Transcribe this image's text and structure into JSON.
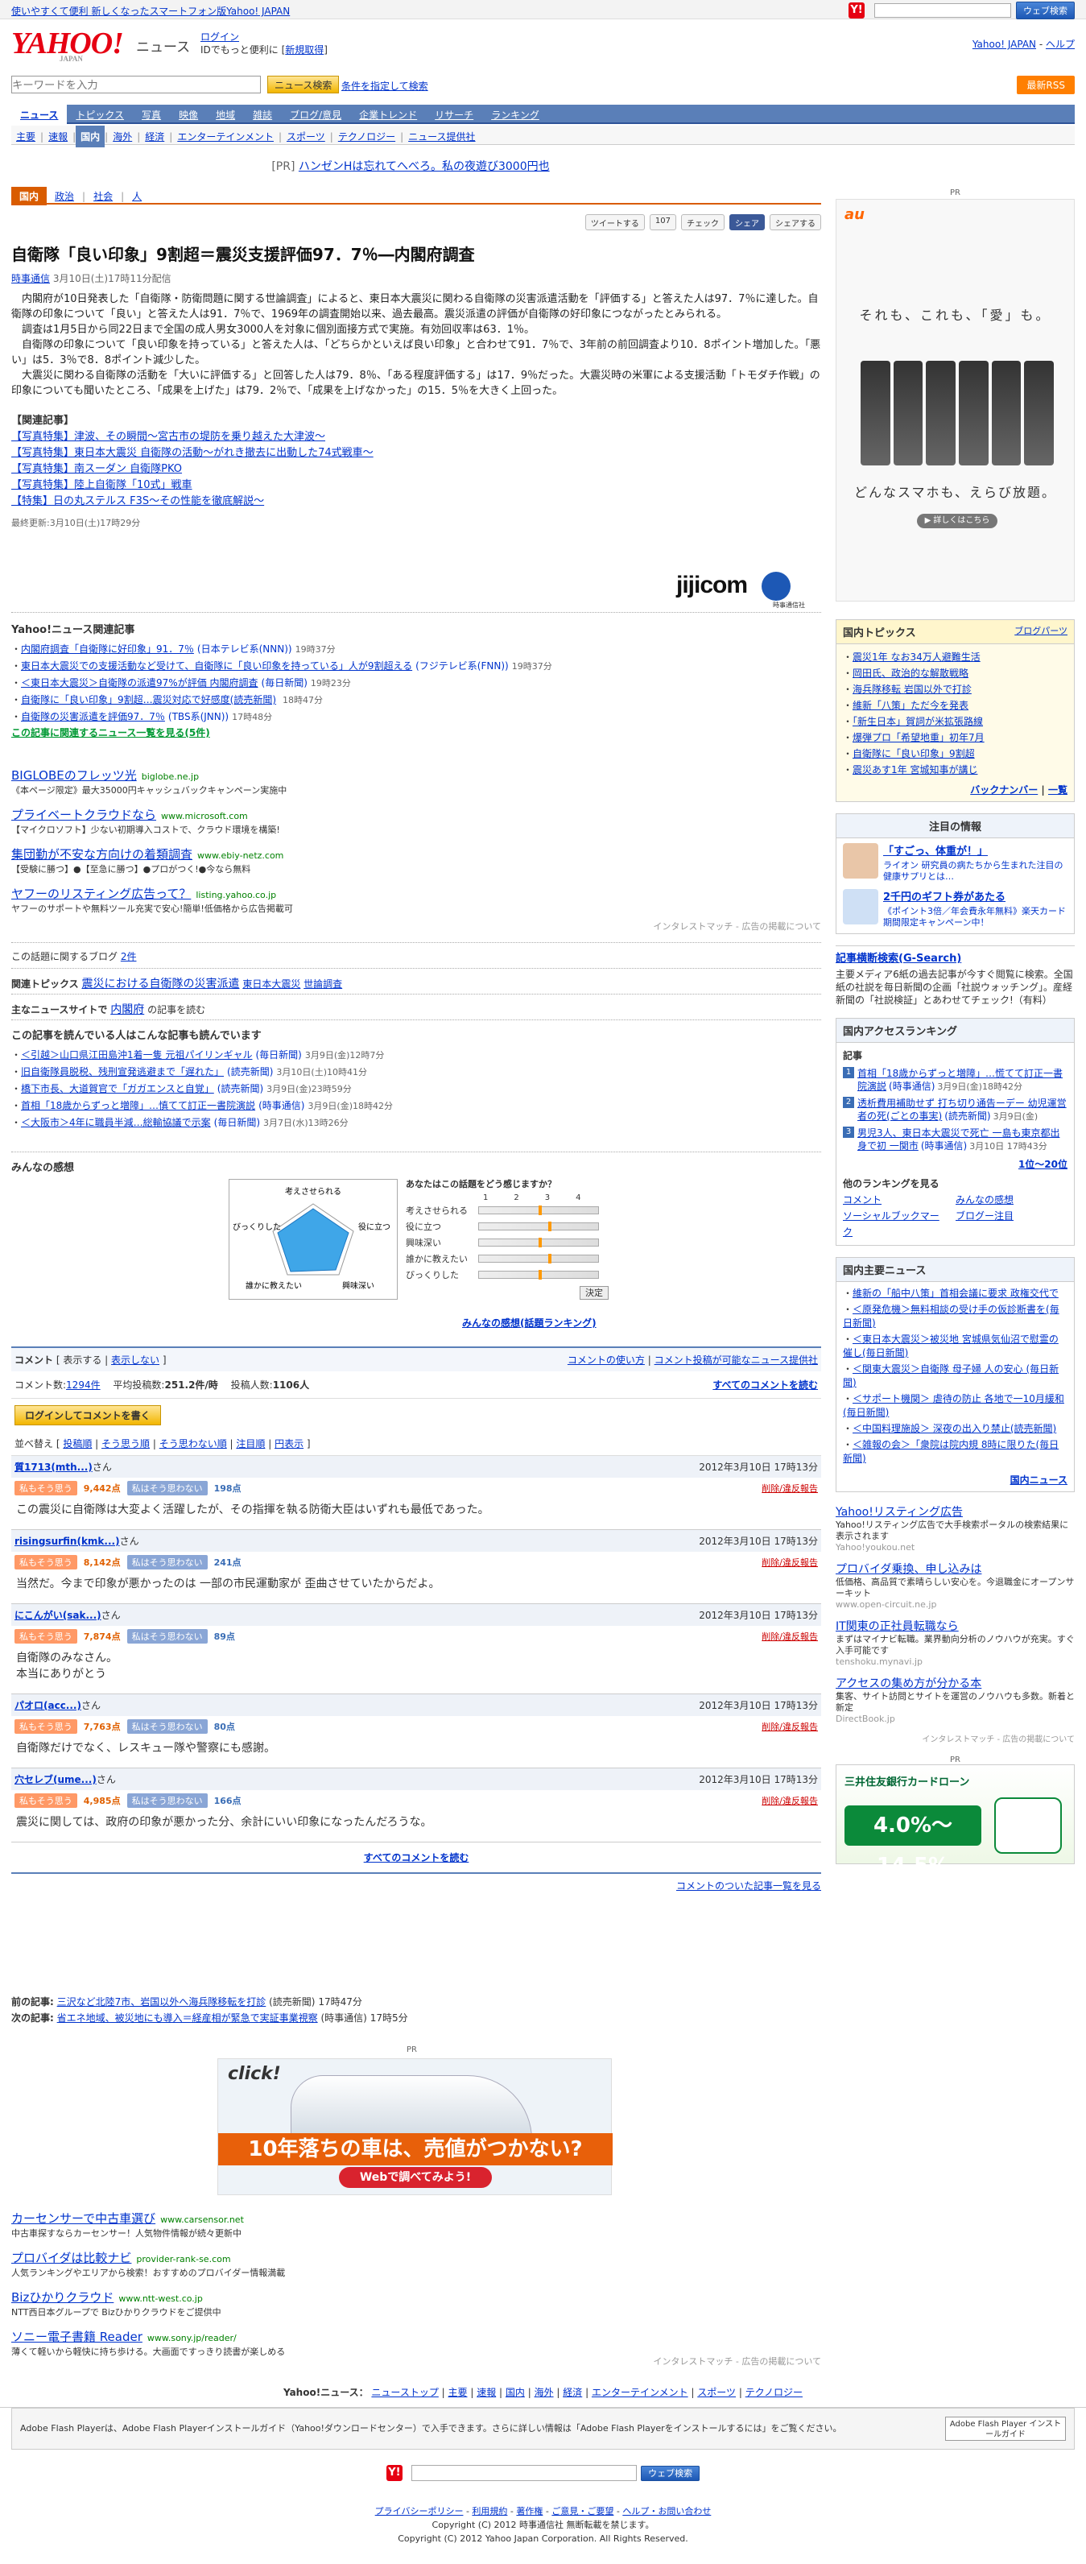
{
  "topbar": {
    "promo": "使いやすくて便利 新しくなったスマートフォン版Yahoo! JAPAN",
    "search_button": "ウェブ検索",
    "y_icon": "Y!"
  },
  "header": {
    "logo": "YAHOO!",
    "logo_sub": "JAPAN",
    "section": "ニュース",
    "login": "ログイン",
    "login_note": "IDでもっと便利に",
    "register": "新規取得",
    "right_link": "Yahoo! JAPAN",
    "help": "ヘルプ"
  },
  "search": {
    "placeholder": "キーワードを入力",
    "button": "ニュース検索",
    "advanced": "条件を指定して検索",
    "rss": "最新RSS"
  },
  "nav": [
    "ニュース",
    "トピックス",
    "写真",
    "映像",
    "地域",
    "雑誌",
    "ブログ/意見",
    "企業トレンド",
    "リサーチ",
    "ランキング"
  ],
  "subnav": [
    "主要",
    "速報",
    "国内",
    "海外",
    "経済",
    "エンターテインメント",
    "スポーツ",
    "テクノロジー",
    "ニュース提供社"
  ],
  "pr_line": {
    "label": "[PR]",
    "text": "ハンゼンHは忘れてへべろ。私の夜遊び3000円也"
  },
  "cattabs": [
    "国内",
    "政治",
    "社会",
    "人"
  ],
  "social": {
    "tweet": "ツイートする",
    "tweet_count": "107",
    "check": "チェック",
    "fb": "シェア",
    "share": "シェアする"
  },
  "article": {
    "title": "自衛隊「良い印象」9割超＝震災支援評価97．7％―内閣府調査",
    "source": "時事通信",
    "date": "3月10日(土)17時11分配信",
    "paragraphs": [
      "　内閣府が10日発表した「自衛隊・防衛問題に関する世論調査」によると、東日本大震災に関わる自衛隊の災害派遣活動を「評価する」と答えた人は97．7％に達した。自衛隊の印象について「良い」と答えた人は91．7％で、1969年の調査開始以来、過去最高。震災派遣の評価が自衛隊の好印象につながったとみられる。",
      "　調査は1月5日から同22日まで全国の成人男女3000人を対象に個別面接方式で実施。有効回収率は63．1％。",
      "　自衛隊の印象について「良い印象を持っている」と答えた人は、「どちらかといえば良い印象」と合わせて91．7％で、3年前の前回調査より10．8ポイント増加した。「悪い」は5．3％で8．8ポイント減少した。",
      "　大震災に関わる自衛隊の活動を「大いに評価する」と回答した人は79．8％、「ある程度評価する」は17．9％だった。大震災時の米軍による支援活動「トモダチ作戦」の印象についても聞いたところ、「成果を上げた」は79．2％で、「成果を上げなかった」の15．5％を大きく上回った。"
    ],
    "related_heading": "【関連記事】",
    "related": [
      "【写真特集】津波、その瞬間～宮古市の堤防を乗り越えた大津波～",
      "【写真特集】東日本大震災 自衛隊の活動～がれき撤去に出動した74式戦車～",
      "【写真特集】南スーダン 自衛隊PKO",
      "【写真特集】陸上自衛隊「10式」戦車",
      "【特集】日の丸ステルス F3S～その性能を徹底解説～"
    ],
    "final": "最終更新:3月10日(土)17時29分",
    "jiji_logo": "jijicom",
    "jiji_label": "時事通信社"
  },
  "related_news": {
    "heading": "Yahoo!ニュース関連記事",
    "items": [
      {
        "t": "内閣府調査「自衛隊に好印象」91．7％",
        "s": "(日本テレビ系(NNN))",
        "d": "19時37分"
      },
      {
        "t": "東日本大震災での支援活動など受けて、自衛隊に「良い印象を持っている」人が9割超える",
        "s": "(フジテレビ系(FNN))",
        "d": "19時37分"
      },
      {
        "t": "＜東日本大震災＞自衛隊の派遣97%が評価 内閣府調査",
        "s": "(毎日新聞)",
        "d": "19時23分"
      },
      {
        "t": "自衛隊に「良い印象」9割超…震災対応で好感度(読売新聞)",
        "s": "",
        "d": "18時47分"
      },
      {
        "t": "自衛隊の災害派遣を評価97．7％",
        "s": "(TBS系(JNN))",
        "d": "17時48分"
      }
    ],
    "more": "この記事に関連するニュース一覧を見る(5件)"
  },
  "ads1": [
    {
      "t": "BIGLOBEのフレッツ光",
      "u": "biglobe.ne.jp",
      "d": "《本ページ限定》最大35000円キャッシュバックキャンペーン実施中"
    },
    {
      "t": "プライベートクラウドなら",
      "u": "www.microsoft.com",
      "d": "【マイクロソフト】少ない初期導入コストで、クラウド環境を構築!"
    },
    {
      "t": "集団勤が不安な方向けの着類調査",
      "u": "www.ebiy-netz.com",
      "d": "【受験に勝つ】●【至急に勝つ】●プロがつく!●今なら無料"
    },
    {
      "t": "ヤフーのリスティング広告って？",
      "u": "listing.yahoo.co.jp",
      "d": "ヤフーのサポートや無料ツール充実で安心!簡単!低価格から広告掲載可"
    }
  ],
  "ads1_foot": "インタレストマッチ - 広告の掲載について",
  "blog": {
    "label": "この話題に関するブログ",
    "count": "2件"
  },
  "topics": {
    "label": "関連トピックス",
    "main": "震災における自衛隊の災害派遣",
    "sub1": "東日本大震災",
    "sub2": "世論調査"
  },
  "major_site": {
    "label": "主なニュースサイトで",
    "link": "内閣府",
    "suffix": "の記事を読む"
  },
  "also_read": {
    "heading": "この記事を読んでいる人はこんな記事も読んでいます",
    "items": [
      {
        "t": "＜引越＞山口県江田島沖1着一隻 元祖パイリンギャル",
        "s": "(毎日新聞)",
        "d": "3月9日(金)12時7分"
      },
      {
        "t": "旧自衛隊員脱税、残刑宣発逃避まで「遅れた」",
        "s": "(読売新聞)",
        "d": "3月10日(土)10時41分"
      },
      {
        "t": "橋下市長、大道賀官で「ガガエンスと自覚」",
        "s": "(読売新聞)",
        "d": "3月9日(金)23時59分"
      },
      {
        "t": "首相「18歳からずっと増障」…慎てて訂正一書院演説",
        "s": "(時事通信)",
        "d": "3月9日(金)18時42分"
      },
      {
        "t": "＜大阪市＞4年に職員半減…総輸協議で示案",
        "s": "(毎日新聞)",
        "d": "3月7日(水)13時26分"
      }
    ]
  },
  "kansou": {
    "heading": "みんなの感想",
    "question": "あなたはこの話題をどう感じますか？",
    "radar_labels": [
      "考えさせられる",
      "役に立つ",
      "興味深い",
      "誰かに教えたい",
      "びっくりした"
    ],
    "scale": [
      "1",
      "2",
      "3",
      "4"
    ],
    "vote_labels": [
      "考えさせられる",
      "役に立つ",
      "興味深い",
      "誰かに教えたい",
      "びっくりした"
    ],
    "decide": "決定",
    "ranking": "みんなの感想(話題ランキング)"
  },
  "comments": {
    "label": "コメント",
    "show": "表示する",
    "hide": "表示しない",
    "howto": "コメントの使い方",
    "post_link": "コメント投稿が可能なニュース提供社",
    "count_label": "コメント数:",
    "count": "1294件",
    "avg_label": "平均投稿数:",
    "avg": "251.2件/時",
    "users_label": "投稿人数:",
    "users": "1106人",
    "all": "すべてのコメントを読む",
    "login_btn": "ログインしてコメントを書く",
    "sort_label": "並べ替え",
    "sorts": [
      "投稿順",
      "そう思う順",
      "そう思わない順",
      "注目順",
      "円表示"
    ],
    "yes_label": "私もそう思う",
    "no_label": "私はそう思わない",
    "report": "削除/違反報告",
    "items": [
      {
        "u": "質1713(mth...)",
        "suffix": "さん",
        "time": "2012年3月10日 17時13分",
        "y": "9,442点",
        "n": "198点",
        "text": "この震災に自衛隊は大変よく活躍したが、その指揮を執る防衛大臣はいずれも最低であった。"
      },
      {
        "u": "risingsurfin(kmk...)",
        "suffix": "さん",
        "time": "2012年3月10日 17時13分",
        "y": "8,142点",
        "n": "241点",
        "text": "当然だ。今まで印象が悪かったのは 一部の市民運動家が 歪曲させていたからだよ。"
      },
      {
        "u": "にこんがい(sak...)",
        "suffix": "さん",
        "time": "2012年3月10日 17時13分",
        "y": "7,874点",
        "n": "89点",
        "text": "自衛隊のみなさん。\n本当にありがとう"
      },
      {
        "u": "パオロ(acc...)",
        "suffix": "さん",
        "time": "2012年3月10日 17時13分",
        "y": "7,763点",
        "n": "80点",
        "text": "自衛隊だけでなく、レスキュー隊や警察にも感謝。"
      },
      {
        "u": "穴セレブ(ume...)",
        "suffix": "さん",
        "time": "2012年3月10日 17時13分",
        "y": "4,985点",
        "n": "166点",
        "text": "震災に関しては、政府の印象が悪かった分、余計にいい印象になったんだろうな。"
      }
    ],
    "all_bottom": "すべてのコメントを読む",
    "list_link": "コメントのついた記事一覧を見る"
  },
  "prevnext": {
    "prev_label": "前の記事:",
    "prev": "三沢など北陸7市、岩国以外へ海兵隊移転を打診",
    "prev_src": "(読売新聞)",
    "prev_time": "17時47分",
    "next_label": "次の記事:",
    "next": "省エネ地域、被災地にも導入＝経産相が緊急で実証事業視察",
    "next_src": "(時事通信)",
    "next_time": "17時5分"
  },
  "car_ad": {
    "pr": "PR",
    "click": "click!",
    "band": "10年落ちの車は、売値がつかない?",
    "web": "Webで調べてみよう!"
  },
  "ads2": [
    {
      "t": "カーセンサーで中古車選び",
      "u": "www.carsensor.net",
      "d": "中古車探すならカーセンサー！人気物件情報が続々更新中"
    },
    {
      "t": "プロバイダは比較ナビ",
      "u": "provider-rank-se.com",
      "d": "人気ランキングやエリアから検索！おすすめのプロバイダー情報満載"
    },
    {
      "t": "Bizひかりクラウド",
      "u": "www.ntt-west.co.jp",
      "d": "NTT西日本グループで Bizひかりクラウドをご提供中"
    },
    {
      "t": "ソニー電子書籍 Reader",
      "u": "www.sony.jp/reader/",
      "d": "薄くて軽いから軽快に持ち歩ける。大画面ですっきり読書が楽しめる"
    }
  ],
  "ads2_foot": "インタレストマッチ - 広告の掲載について",
  "footnav": {
    "label": "Yahoo!ニュース：",
    "links": [
      "ニューストップ",
      "主要",
      "速報",
      "国内",
      "海外",
      "経済",
      "エンターテインメント",
      "スポーツ",
      "テクノロジー"
    ]
  },
  "flash": {
    "text": "Adobe Flash Playerは、Adobe Flash Playerインストールガイド（Yahoo!ダウンロードセンター）で入手できます。さらに詳しい情報は「Adobe Flash Playerをインストールするには」をご覧ください。",
    "badge": "Adobe Flash Player インストールガイド"
  },
  "foot_links": {
    "row1": [
      "プライバシーポリシー",
      "利用規約",
      "著作権",
      "ご意見・ご要望",
      "ヘルプ・お問い合わせ"
    ],
    "row2": "Copyright (C) 2012 時事通信社 無断転載を禁じます。",
    "row3": "Copyright (C) 2012 Yahoo Japan Corporation. All Rights Reserved."
  },
  "sidebar": {
    "pr": "PR",
    "au": {
      "logo": "au",
      "t1": "それも、これも、「愛」も。",
      "t2": "どんなスマホも、えらび放題。",
      "btn": "▶ 詳しくはこちら"
    },
    "topics": {
      "h": "国内トピックス",
      "tab": "ブログパーツ",
      "items": [
        "震災1年 なお34万人避難生活",
        "岡田氏、政治的な解散戦略",
        "海兵隊移転 岩国以外で打診",
        "維新「八策」ただ今を発表",
        "「新生日本」賀詞が米拡張路線",
        "爆弾プロ「希望地重」初年7月",
        "自衛隊に「良い印象」9割超",
        "震災あす1年 宮城知事が講じ"
      ],
      "back": "バックナンバー",
      "list": "一覧"
    },
    "chumoku": {
      "h": "注目の情報",
      "i1t": "「すごっ、体重が！」",
      "i1d": "ライオン 研究員の病たちから生まれた注目の健康サプリとは…",
      "i2t": "2千円のギフト券があたる",
      "i2d": "《ポイント3倍／年会費永年無料》楽天カード 期間限定キャンペーン中！"
    },
    "gsearch": {
      "h": "記事横断検索(G-Search)",
      "text": "主要メディア6紙の過去記事が今すぐ閲覧に検索。全国紙の社説を毎日新聞の企画「社説ウォッチング」。産経新聞の「社説検証」とあわせてチェック!（有料）"
    },
    "access": {
      "h": "国内アクセスランキング",
      "label": "記事",
      "items": [
        {
          "t": "首相「18歳からずっと増障」…慌てて訂正一書院演説",
          "s": "(時事通信)",
          "d": "3月9日(金)18時42分"
        },
        {
          "t": "透析費用補助せず 打ち切り通告ーデー 幼児運営者の死(ごとの事実)",
          "s": "(読売新聞)",
          "d": "3月9日(金)"
        },
        {
          "t": "男児3人、東日本大震災で死亡 一島も東京都出身で初 一関市",
          "s": "(時事通信)",
          "d": "3月10日 17時43分"
        }
      ],
      "more": "1位〜20位",
      "other_h": "他のランキングを見る",
      "o1": "コメント",
      "o2": "みんなの感想",
      "o3": "ソーシャルブックマーク",
      "o4": "ブログー注目"
    },
    "major": {
      "h": "国内主要ニュース",
      "items": [
        "維新の「船中八策」首相会議に要求 政権交代で",
        "＜原発危機＞無料相談の受け手の仮診断書を(毎日新聞)",
        "＜東日本大震災＞被災地 宮城県気仙沼で慰霊の催し(毎日新聞)",
        "＜関東大震災＞自衛隊 母子婦 人の安心 (毎日新聞)",
        "＜サポート機関＞ 虐待の防止 各地で一10月緩和(毎日新聞)",
        "＜中国料理施設＞ 深夜の出入り禁止(読売新聞)",
        "＜雑報の会＞「衆院は院内規 8時に限りた(毎日新聞)"
      ],
      "more": "国内ニュース"
    },
    "listing": {
      "items": [
        {
          "t": "Yahoo!リスティング広告",
          "d": "Yahoo!リスティング広告で大手検索ポータルの検索結果に表示されます",
          "u": "Yahoo!youkou.net"
        },
        {
          "t": "プロバイダ乗換、申し込みは",
          "d": "低価格、高品質で素晴らしい安心を。今退職金にオープンサーキット",
          "u": "www.open-circuit.ne.jp"
        },
        {
          "t": "IT関東の正社員転職なら",
          "d": "まずはマイナビ転職。業界動向分析のノウハウが充実。すぐ入手可能です",
          "u": "tenshoku.mynavi.jp"
        },
        {
          "t": "アクセスの集め方が分かる本",
          "d": "集客、サイト訪問とサイトを運営のノウハウも多数。新着と新定",
          "u": "DirectBook.jp"
        }
      ],
      "foot": "インタレストマッチ - 広告の掲載について"
    },
    "loan": {
      "pr": "PR",
      "name": "三井住友銀行カードローン",
      "rate": "4.0%〜14.5%"
    }
  }
}
